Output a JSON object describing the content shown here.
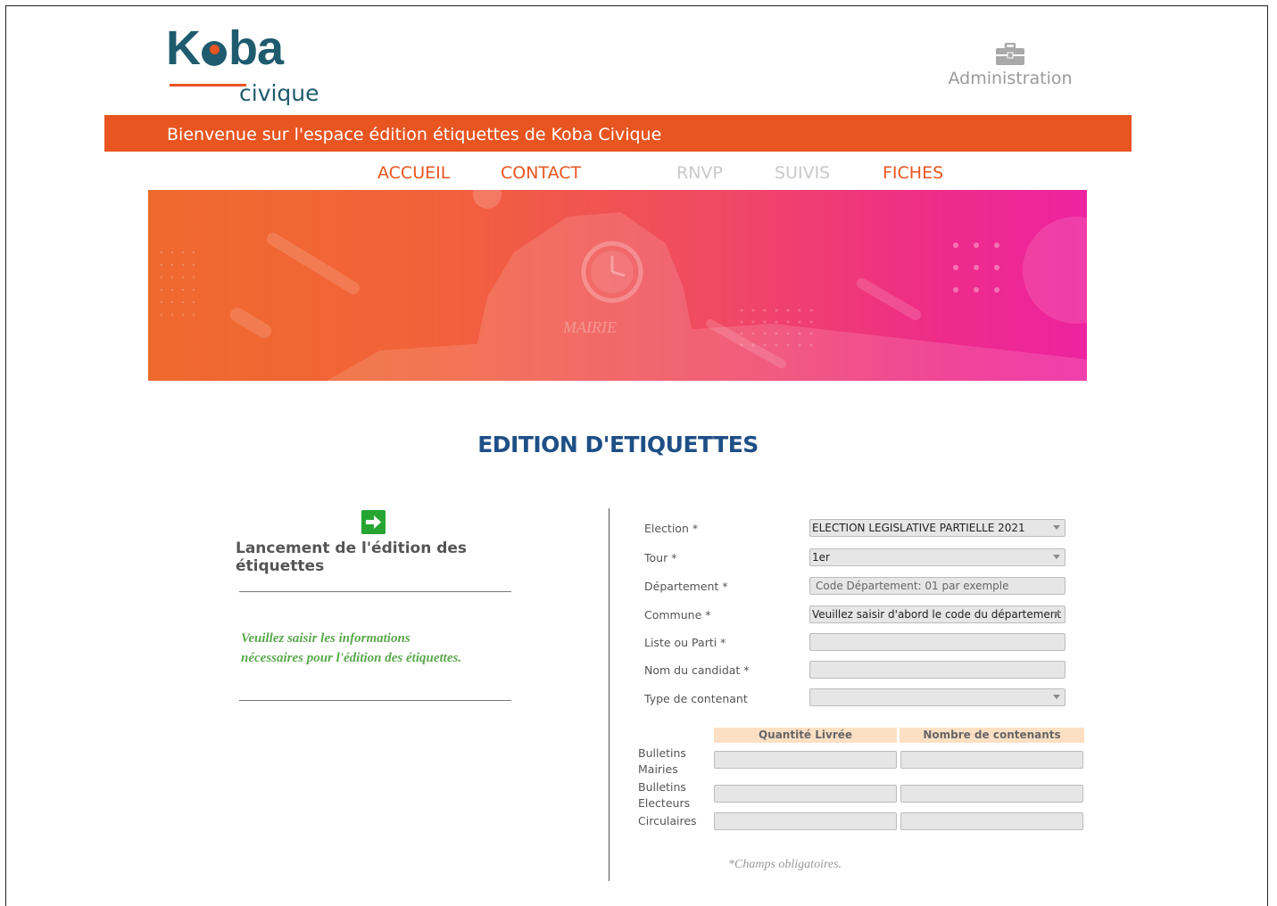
{
  "brand": {
    "logo_main": "Koba",
    "logo_sub": "civique"
  },
  "admin": {
    "label": "Administration",
    "icon": "briefcase-icon"
  },
  "welcome": {
    "text": "Bienvenue sur l'espace édition étiquettes de Koba Civique"
  },
  "nav": {
    "items": [
      {
        "label": "ACCUEIL",
        "state": "active"
      },
      {
        "label": "CONTACT",
        "state": "active"
      },
      {
        "label": "RNVP",
        "state": "disabled"
      },
      {
        "label": "SUIVIS",
        "state": "disabled"
      },
      {
        "label": "FICHES",
        "state": "active"
      }
    ]
  },
  "hero": {
    "sign": "MAIRIE"
  },
  "page": {
    "title": "EDITION D'ETIQUETTES"
  },
  "left_panel": {
    "launch_icon": "arrow-right-icon",
    "launch_title": "Lancement de l'édition des étiquettes",
    "hint_line1": "Veuillez saisir les informations",
    "hint_line2": "nécessaires pour l'édition des étiquettes."
  },
  "form": {
    "election": {
      "label": "Election *",
      "value": "ELECTION LEGISLATIVE PARTIELLE 2021"
    },
    "tour": {
      "label": "Tour *",
      "value": "1er"
    },
    "departement": {
      "label": "Département *",
      "placeholder": "Code Département: 01 par exemple"
    },
    "commune": {
      "label": "Commune *",
      "value": "Veuillez saisir d'abord le code du département"
    },
    "liste": {
      "label": "Liste ou Parti *",
      "value": ""
    },
    "candidat": {
      "label": "Nom du candidat *",
      "value": ""
    },
    "contenant": {
      "label": "Type de contenant",
      "value": ""
    }
  },
  "quantities": {
    "headers": [
      "Quantité Livrée",
      "Nombre de contenants"
    ],
    "rows": [
      {
        "label": "Bulletins Mairies"
      },
      {
        "label": "Bulletins Electeurs"
      },
      {
        "label": "Circulaires"
      }
    ]
  },
  "required_note": "*Champs obligatoires.",
  "colors": {
    "orange": "#e85520",
    "teal": "#1f5b6e",
    "title_blue": "#1e4f86",
    "hint_green": "#5aa84c"
  }
}
